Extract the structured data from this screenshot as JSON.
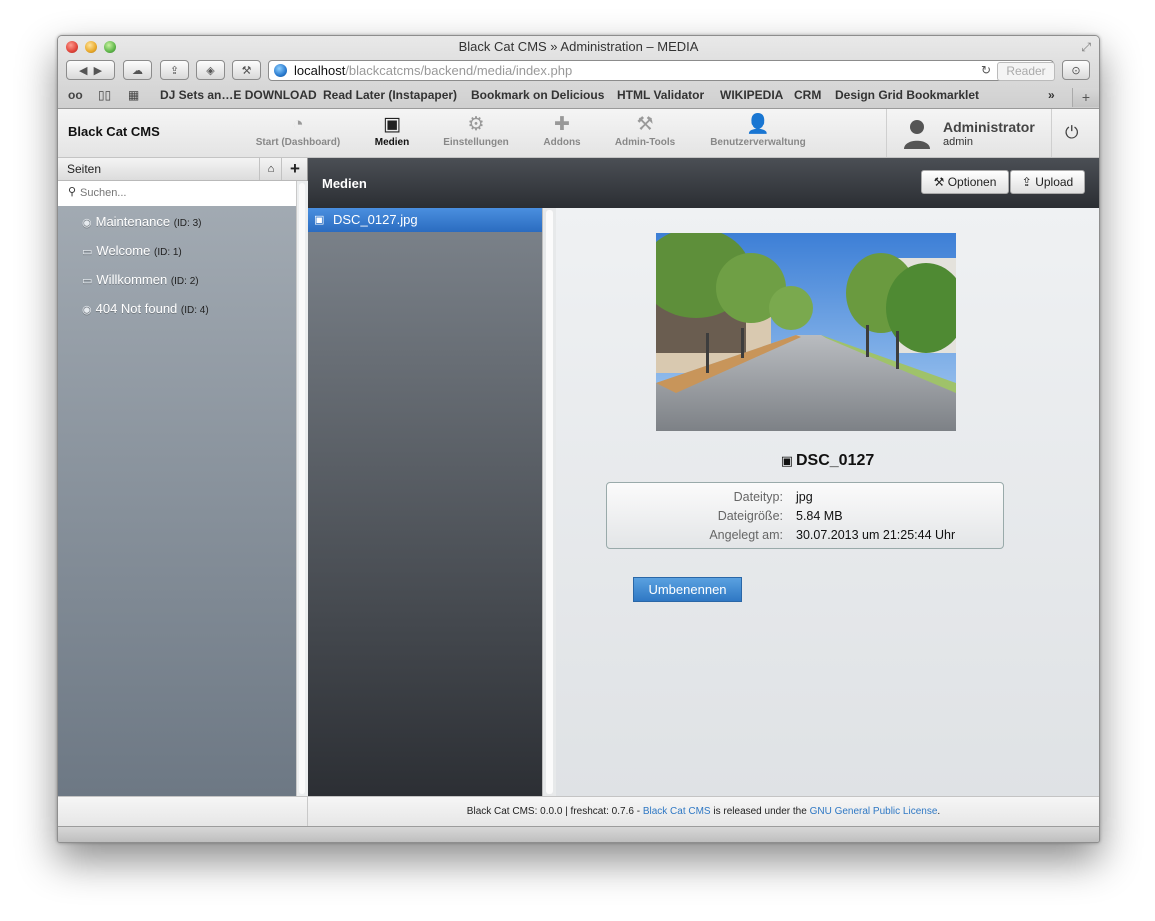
{
  "browser": {
    "window_title": "Black Cat CMS » Administration – MEDIA",
    "url_host": "localhost",
    "url_path": "/blackcatcms/backend/media/index.php",
    "reader_label": "Reader",
    "bookmarks": [
      "DJ Sets an…E DOWNLOAD",
      "Read Later (Instapaper)",
      "Bookmark on Delicious",
      "HTML Validator",
      "WIKIPEDIA",
      "CRM",
      "Design Grid Bookmarklet"
    ]
  },
  "app": {
    "brand": "Black Cat CMS",
    "nav": [
      {
        "label": "Start (Dashboard)",
        "icon": "dashboard-icon",
        "glyph": "◔",
        "active": false
      },
      {
        "label": "Medien",
        "icon": "image-icon",
        "glyph": "▣",
        "active": true
      },
      {
        "label": "Einstellungen",
        "icon": "gears-icon",
        "glyph": "⚙",
        "active": false
      },
      {
        "label": "Addons",
        "icon": "puzzle-icon",
        "glyph": "✚",
        "active": false
      },
      {
        "label": "Admin-Tools",
        "icon": "wrench-icon",
        "glyph": "⚒",
        "active": false
      },
      {
        "label": "Benutzerverwaltung",
        "icon": "users-icon",
        "glyph": "👤",
        "active": false
      }
    ],
    "user": {
      "name": "Administrator",
      "login": "admin"
    }
  },
  "sidebar": {
    "title": "Seiten",
    "search_placeholder": "Suchen...",
    "pages": [
      {
        "label": "Maintenance",
        "id": "(ID: 3)",
        "icon": "eye-icon",
        "glyph": "◉"
      },
      {
        "label": "Welcome",
        "id": "(ID: 1)",
        "icon": "monitor-icon",
        "glyph": "▭"
      },
      {
        "label": "Willkommen",
        "id": "(ID: 2)",
        "icon": "monitor-icon",
        "glyph": "▭"
      },
      {
        "label": "404 Not found",
        "id": "(ID: 4)",
        "icon": "eye-icon",
        "glyph": "◉"
      }
    ]
  },
  "content": {
    "title": "Medien",
    "options_label": "Optionen",
    "upload_label": "Upload",
    "files": [
      {
        "name": "DSC_0127.jpg"
      }
    ],
    "detail": {
      "name": "DSC_0127",
      "rows": [
        {
          "key": "Dateityp:",
          "value": "jpg"
        },
        {
          "key": "Dateigröße:",
          "value": "5.84 MB"
        },
        {
          "key": "Angelegt am:",
          "value": "30.07.2013 um 21:25:44 Uhr"
        }
      ],
      "rename_label": "Umbenennen"
    }
  },
  "footer": {
    "prefix": "Black Cat CMS: 0.0.0 | freshcat: 0.7.6 - ",
    "link1": "Black Cat CMS",
    "middle": " is released under the ",
    "link2": "GNU General Public License",
    "suffix": "."
  }
}
